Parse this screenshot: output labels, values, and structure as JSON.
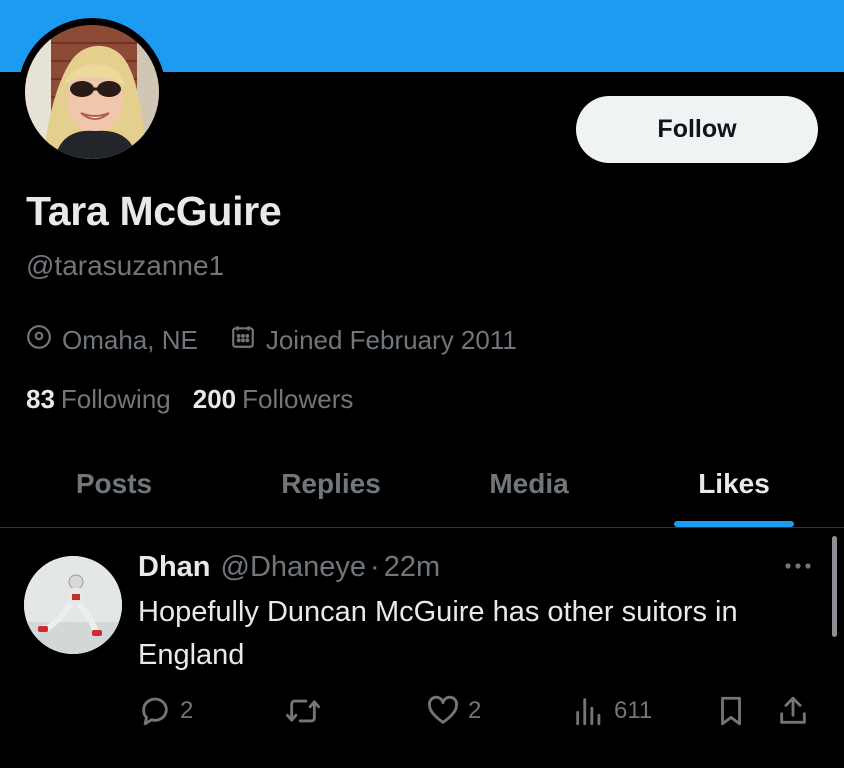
{
  "profile": {
    "name": "Tara McGuire",
    "handle": "@tarasuzanne1",
    "location": "Omaha, NE",
    "joined": "Joined February 2011",
    "following_count": "83",
    "following_label": "Following",
    "followers_count": "200",
    "followers_label": "Followers",
    "follow_label": "Follow"
  },
  "tabs": [
    {
      "label": "Posts",
      "active": false
    },
    {
      "label": "Replies",
      "active": false
    },
    {
      "label": "Media",
      "active": false
    },
    {
      "label": "Likes",
      "active": true
    }
  ],
  "tweet": {
    "author": "Dhan",
    "handle": "@Dhaneye",
    "separator": "·",
    "time": "22m",
    "text": "Hopefully Duncan McGuire has other suitors in England",
    "replies": "2",
    "likes": "2",
    "views": "611"
  },
  "colors": {
    "banner": "#1d9bf0",
    "accent": "#1d9bf0",
    "background": "#000000",
    "secondary_text": "#71767b"
  },
  "icons": [
    "location-icon",
    "calendar-icon",
    "reply-icon",
    "retweet-icon",
    "like-icon",
    "views-icon",
    "bookmark-icon",
    "share-icon",
    "more-icon"
  ]
}
